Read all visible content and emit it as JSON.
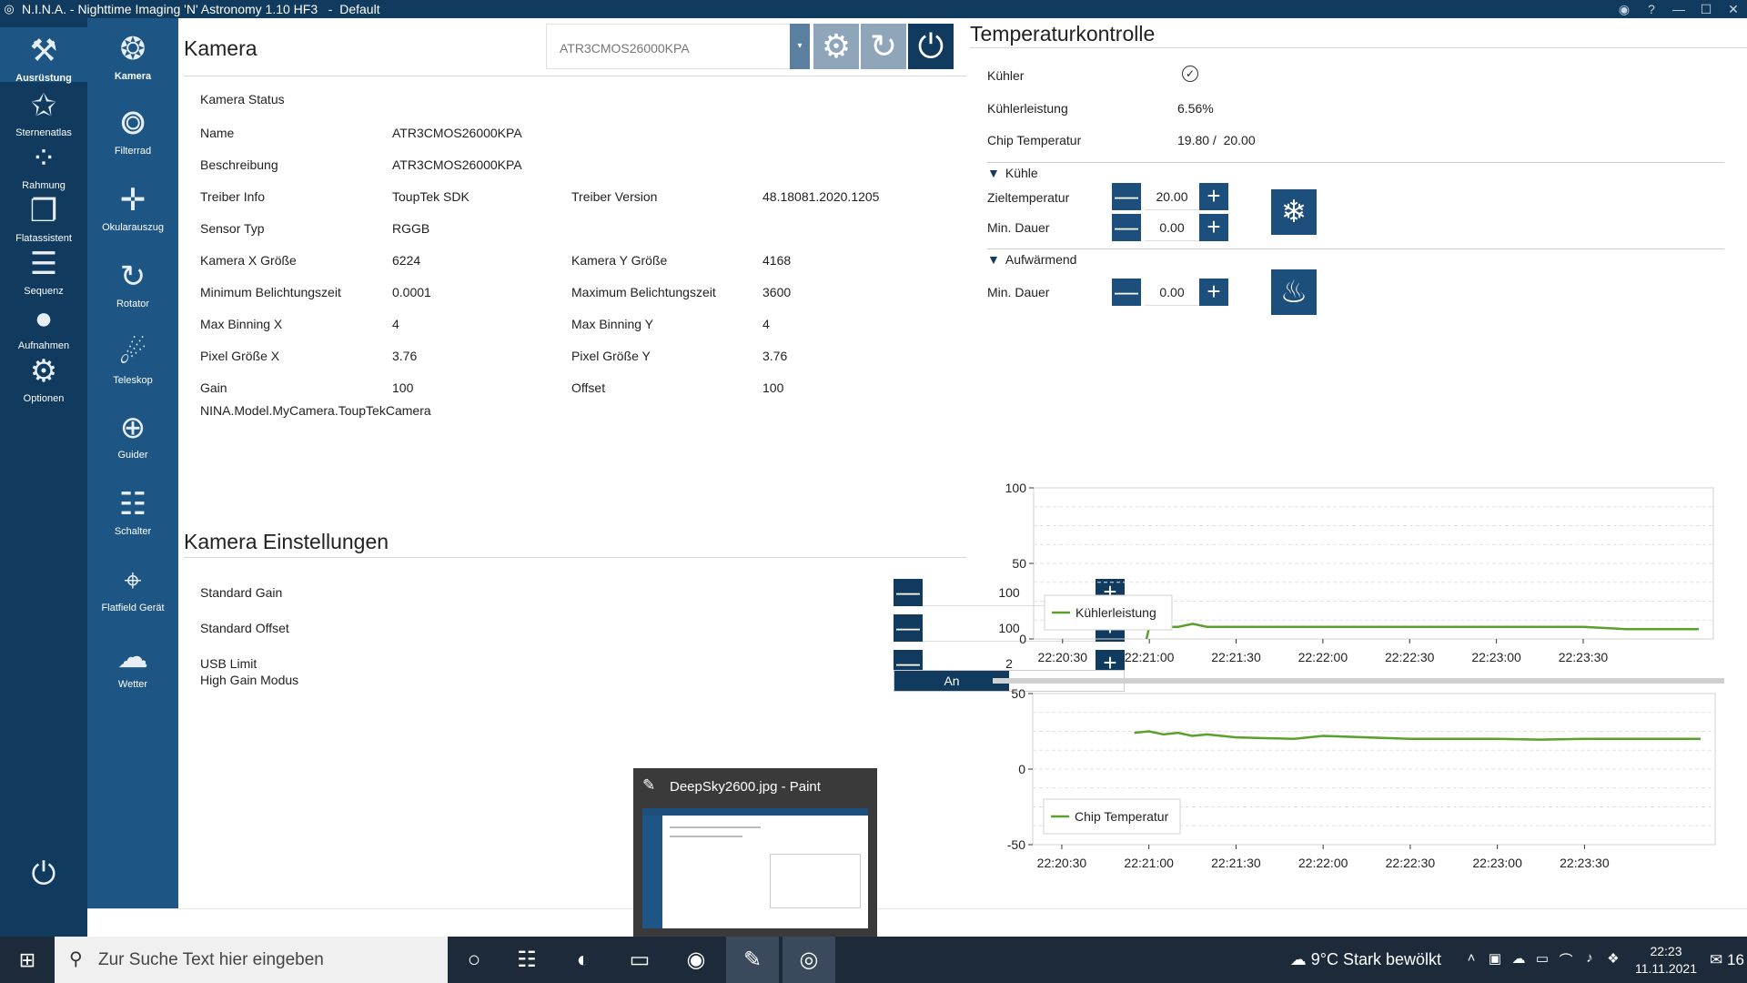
{
  "window": {
    "title": "N.I.N.A. - Nighttime Imaging 'N' Astronomy 1.10 HF3   -  Default",
    "buttons": [
      "◉",
      "?",
      "—",
      "☐",
      "✕"
    ]
  },
  "nav_primary": [
    {
      "label": "Ausrüstung",
      "icon": "equipment-icon",
      "glyph": "⚒",
      "active": true
    },
    {
      "label": "Sternenatlas",
      "icon": "star-atlas-icon",
      "glyph": "✩"
    },
    {
      "label": "Rahmung",
      "icon": "framing-icon",
      "glyph": "⁘"
    },
    {
      "label": "Flatassistent",
      "icon": "flat-wizard-icon",
      "glyph": "❐"
    },
    {
      "label": "Sequenz",
      "icon": "sequence-icon",
      "glyph": "☰"
    },
    {
      "label": "Aufnahmen",
      "icon": "imaging-icon",
      "glyph": "●"
    },
    {
      "label": "Optionen",
      "icon": "options-icon",
      "glyph": "⚙"
    }
  ],
  "nav_power_glyph": "⏻",
  "nav_secondary": [
    {
      "label": "Kamera",
      "icon": "camera-icon",
      "glyph": "❂",
      "active": true
    },
    {
      "label": "Filterrad",
      "icon": "filter-wheel-icon",
      "glyph": "⭗"
    },
    {
      "label": "Okularauszug",
      "icon": "focuser-icon",
      "glyph": "✛"
    },
    {
      "label": "Rotator",
      "icon": "rotator-icon",
      "glyph": "↻"
    },
    {
      "label": "Teleskop",
      "icon": "telescope-icon",
      "glyph": "☄"
    },
    {
      "label": "Guider",
      "icon": "guider-icon",
      "glyph": "⊕"
    },
    {
      "label": "Schalter",
      "icon": "switch-icon",
      "glyph": "☷"
    },
    {
      "label": "Flatfield Gerät",
      "icon": "flat-device-icon",
      "glyph": "⌖"
    },
    {
      "label": "Wetter",
      "icon": "weather-icon",
      "glyph": "☁"
    }
  ],
  "camera": {
    "heading": "Kamera",
    "selected_device": "ATR3CMOS26000KPA",
    "dropdown_glyph": "▾",
    "btn_settings_glyph": "⚙",
    "btn_refresh_glyph": "↻",
    "btn_power_glyph": "⏻",
    "status_label": "Kamera Status",
    "rows": [
      {
        "label": "Name",
        "value": "ATR3CMOS26000KPA"
      },
      {
        "label": "Beschreibung",
        "value": "ATR3CMOS26000KPA"
      },
      {
        "label": "Treiber Info",
        "value": "ToupTek SDK",
        "label2": "Treiber Version",
        "value2": "48.18081.2020.1205"
      },
      {
        "label": "Sensor Typ",
        "value": "RGGB"
      },
      {
        "label": "Kamera X Größe",
        "value": "6224",
        "label2": "Kamera Y Größe",
        "value2": "4168"
      },
      {
        "label": "Minimum Belichtungszeit",
        "value": "0.0001",
        "label2": "Maximum Belichtungszeit",
        "value2": "3600"
      },
      {
        "label": "Max Binning X",
        "value": "4",
        "label2": "Max Binning Y",
        "value2": "4"
      },
      {
        "label": "Pixel Größe X",
        "value": "3.76",
        "label2": "Pixel Größe Y",
        "value2": "3.76"
      },
      {
        "label": "Gain",
        "value": "100",
        "label2": "Offset",
        "value2": "100"
      }
    ],
    "model_class": "NINA.Model.MyCamera.ToupTekCamera"
  },
  "settings": {
    "heading": "Kamera Einstellungen",
    "minus_glyph": "—",
    "plus_glyph": "+",
    "rows": [
      {
        "label": "Standard Gain",
        "value": "100"
      },
      {
        "label": "Standard Offset",
        "value": "100"
      },
      {
        "label": "USB Limit",
        "value": "2"
      }
    ],
    "high_gain_label": "High Gain Modus",
    "high_gain_value": "An"
  },
  "temp": {
    "heading": "Temperaturkontrolle",
    "cooler_label": "Kühler",
    "cooler_glyph": "✓",
    "power_label": "Kühlerleistung",
    "power_value": "6.56%",
    "chip_label": "Chip Temperatur",
    "chip_value": "19.80 /  20.00",
    "cool_section": "Kühle",
    "target_label": "Zieltemperatur",
    "target_value": "20.00",
    "min_duration_label": "Min. Dauer",
    "cool_duration_value": "0.00",
    "warm_section": "Aufwärmend",
    "warm_duration_value": "0.00",
    "snow_glyph": "❄",
    "flame_glyph": "♨",
    "tri_glyph": "▼"
  },
  "chart_data": [
    {
      "type": "line",
      "series": [
        {
          "name": "Kühlerleistung",
          "color": "#5aa02c",
          "x": [
            "22:20:59",
            "22:21:00",
            "22:21:05",
            "22:21:10",
            "22:21:15",
            "22:21:20",
            "22:21:30",
            "22:22:00",
            "22:22:30",
            "22:23:00",
            "22:23:30",
            "22:23:45",
            "22:24:00",
            "22:24:10"
          ],
          "values": [
            0,
            8,
            8,
            8,
            10,
            8,
            8,
            8,
            8,
            8,
            8,
            6.5,
            6.5,
            6.5
          ]
        }
      ],
      "x_ticks": [
        "22:20:30",
        "22:21:00",
        "22:21:30",
        "22:22:00",
        "22:22:30",
        "22:23:00",
        "22:23:30"
      ],
      "y_ticks": [
        "100",
        "50",
        "0"
      ],
      "ylim": [
        0,
        100
      ]
    },
    {
      "type": "line",
      "series": [
        {
          "name": "Chip Temperatur",
          "color": "#5aa02c",
          "x": [
            "22:20:55",
            "22:21:00",
            "22:21:05",
            "22:21:10",
            "22:21:15",
            "22:21:20",
            "22:21:30",
            "22:21:40",
            "22:21:50",
            "22:22:00",
            "22:22:30",
            "22:23:00",
            "22:23:15",
            "22:23:30",
            "22:24:10"
          ],
          "values": [
            24,
            25,
            23,
            24,
            22,
            23,
            21,
            20.5,
            20,
            22,
            20,
            20,
            19.5,
            20,
            20
          ]
        }
      ],
      "x_ticks": [
        "22:20:30",
        "22:21:00",
        "22:21:30",
        "22:22:00",
        "22:22:30",
        "22:23:00",
        "22:23:30"
      ],
      "y_ticks": [
        "50",
        "0",
        "-50"
      ],
      "ylim": [
        -50,
        50
      ]
    }
  ],
  "preview": {
    "title": "DeepSky2600.jpg - Paint",
    "icon_glyph": "✎"
  },
  "taskbar": {
    "start_glyph": "⊞",
    "search_glyph": "⚲",
    "search_placeholder": "Zur Suche Text hier eingeben",
    "apps": [
      {
        "name": "cortana-icon",
        "glyph": "○"
      },
      {
        "name": "task-view-icon",
        "glyph": "☷"
      },
      {
        "name": "edge-icon",
        "glyph": "◐"
      },
      {
        "name": "explorer-icon",
        "glyph": "▭"
      },
      {
        "name": "origin-icon",
        "glyph": "◉"
      },
      {
        "name": "paint-icon",
        "glyph": "✎"
      },
      {
        "name": "nina-icon",
        "glyph": "◎"
      }
    ],
    "weather": "☁ 9°C  Stark bewölkt",
    "tray_glyphs": [
      "˄",
      "▣",
      "☁",
      "▭",
      "⌒",
      "♪",
      "❖"
    ],
    "time": "22:23",
    "date": "11.11.2021",
    "notif": "✉ 16"
  }
}
